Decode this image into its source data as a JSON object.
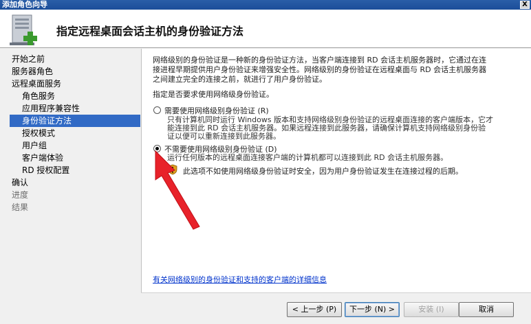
{
  "window": {
    "title": "添加角色向导",
    "close_glyph": "X"
  },
  "header": {
    "title": "指定远程桌面会话主机的身份验证方法"
  },
  "nav": {
    "items": [
      {
        "label": "开始之前"
      },
      {
        "label": "服务器角色"
      },
      {
        "label": "远程桌面服务"
      },
      {
        "label": "角色服务"
      },
      {
        "label": "应用程序兼容性"
      },
      {
        "label": "身份验证方法"
      },
      {
        "label": "授权模式"
      },
      {
        "label": "用户组"
      },
      {
        "label": "客户端体验"
      },
      {
        "label": "RD 授权配置"
      },
      {
        "label": "确认"
      },
      {
        "label": "进度"
      },
      {
        "label": "结果"
      }
    ],
    "selected_index": 5
  },
  "content": {
    "intro_lines": [
      "网络级别的身份验证是一种新的身份验证方法，当客户端连接到 RD 会话主机服务器时，它通过在连",
      "接进程早期提供用户身份验证来增强安全性。网络级别的身份验证在远程桌面与 RD 会话主机服务器",
      "之间建立完全的连接之前，就进行了用户身份验证。"
    ],
    "question": "指定是否要求使用网络级身份验证。",
    "option1": {
      "label": "需要使用网络级别身份验证 (R)",
      "desc_lines": [
        "只有计算机同时运行 Windows 版本和支持网络级别身份验证的远程桌面连接的客户端版本，它才",
        "能连接到此 RD 会话主机服务器。如果远程连接到此服务器，请确保计算机支持网络级别身份验",
        "证以便可以重新连接到此服务器。"
      ],
      "checked": false
    },
    "option2": {
      "label": "不需要使用网络级别身份验证 (D)",
      "desc": "运行任何版本的远程桌面连接客户端的计算机都可以连接到此 RD 会话主机服务器。",
      "checked": true
    },
    "warning": {
      "icon": "warning-shield-icon",
      "text": "此选项不如使用网络级身份验证时安全，因为用户身份验证发生在连接过程的后期。"
    },
    "link": "有关网络级别的身份验证和支持的客户端的详细信息"
  },
  "buttons": {
    "back": "< 上一步 (P)",
    "next": "下一步 (N) >",
    "install": "安装 (I)",
    "cancel": "取消"
  },
  "colors": {
    "selection": "#316ac5",
    "link": "#0033cc",
    "annotation_arrow": "#e8222a"
  }
}
